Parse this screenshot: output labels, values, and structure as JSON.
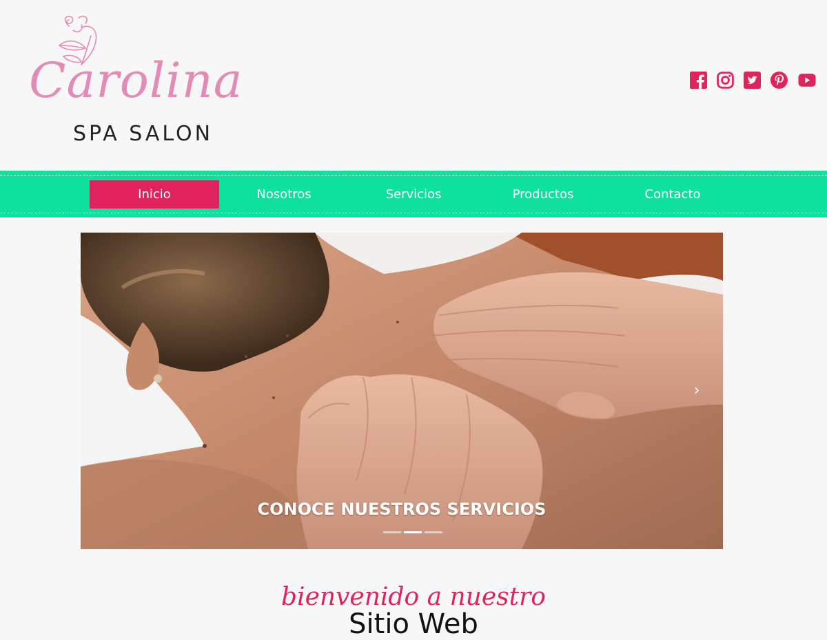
{
  "header": {
    "logo": {
      "script_text": "Carolina",
      "subtitle": "SPA SALON"
    },
    "social": [
      {
        "icon": "facebook-icon",
        "label": "Facebook"
      },
      {
        "icon": "instagram-icon",
        "label": "Instagram"
      },
      {
        "icon": "twitter-icon",
        "label": "Twitter"
      },
      {
        "icon": "pinterest-icon",
        "label": "Pinterest"
      },
      {
        "icon": "youtube-icon",
        "label": "YouTube"
      }
    ]
  },
  "nav": {
    "items": [
      {
        "label": "Inicio",
        "active": true
      },
      {
        "label": "Nosotros",
        "active": false
      },
      {
        "label": "Servicios",
        "active": false
      },
      {
        "label": "Productos",
        "active": false
      },
      {
        "label": "Contacto",
        "active": false
      }
    ]
  },
  "hero": {
    "caption": "CONOCE NUESTROS SERVICIOS",
    "prev_icon": "chevron-left-icon",
    "next_icon": "chevron-right-icon",
    "slides_total": 3,
    "active_slide": 2
  },
  "welcome": {
    "script": "bienvenido a nuestro",
    "title": "Sitio Web"
  },
  "colors": {
    "accent": "#e0235d",
    "nav_bg": "#0fe09e",
    "logo_pink": "#e38bb6",
    "background": "#f7f7f7"
  }
}
